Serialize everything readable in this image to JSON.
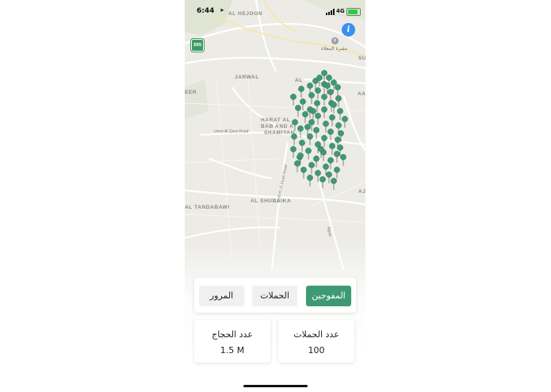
{
  "status_bar": {
    "time": "6:44",
    "network": "4G",
    "battery_level": 0.85
  },
  "map": {
    "labels": {
      "al_hejoon": "AL HEJOON",
      "jarwal": "JARWAL",
      "harat": "HARAT AL",
      "bab": "BAB AND A",
      "shamiyah": "SHAMIYAH",
      "umm_al_qura": "Umm Al Qura Road",
      "al_shubaika": "AL SHUBAIKA",
      "al_tandabawi": "AL TANDABAWI",
      "ibrahim_road": "Ibrahim Al Khalil Road",
      "eer": "EER",
      "aa": "AA",
      "al": "AL",
      "su": "SU",
      "aj": "AJ",
      "ajyad": "Ajyad"
    },
    "poi": {
      "name": "مقبرة المعلاة",
      "icon": "cemetery-icon"
    },
    "route_badge": "305",
    "marker_color": "#3e9a72"
  },
  "tabs": [
    {
      "label": "المرور",
      "active": false
    },
    {
      "label": "الحملات",
      "active": false
    },
    {
      "label": "المفوجين",
      "active": true
    }
  ],
  "stats": {
    "pilgrims": {
      "title": "عدد الحجاج",
      "value": "1.5 M"
    },
    "campaigns": {
      "title": "عدد الحملات",
      "value": "100"
    }
  },
  "colors": {
    "accent": "#3e9a72",
    "info_button": "#3b8ff0"
  }
}
